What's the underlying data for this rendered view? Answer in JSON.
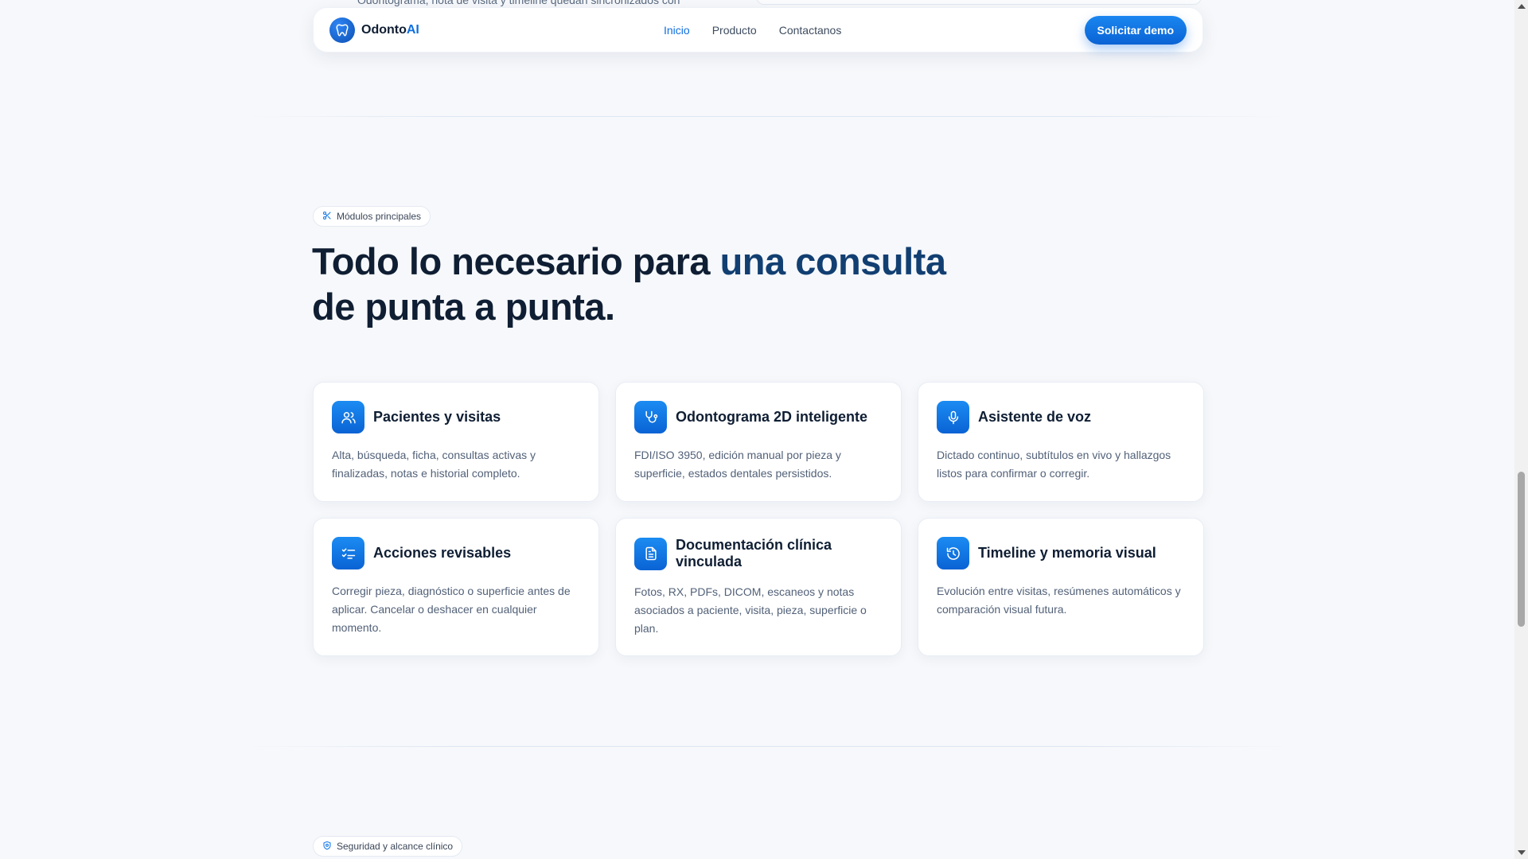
{
  "previous_section": {
    "trailing_text": "Odontograma, nota de visita y timeline quedan sincronizados con"
  },
  "header": {
    "brand_prefix": "Odonto",
    "brand_suffix": "AI",
    "nav": [
      {
        "label": "Inicio",
        "active": true
      },
      {
        "label": "Producto",
        "active": false
      },
      {
        "label": "Contactanos",
        "active": false
      }
    ],
    "cta_label": "Solicitar demo"
  },
  "modules": {
    "eyebrow": "Módulos principales",
    "headline_dark": "Todo lo necesario para ",
    "headline_accent": "una consulta",
    "headline_line2": "de punta a punta.",
    "cards": [
      {
        "icon": "users-icon",
        "title": "Pacientes y visitas",
        "description": "Alta, búsqueda, ficha, consultas activas y finalizadas, notas e historial completo."
      },
      {
        "icon": "stethoscope-icon",
        "title": "Odontograma 2D inteligente",
        "description": "FDI/ISO 3950, edición manual por pieza y superficie, estados dentales persistidos."
      },
      {
        "icon": "microphone-icon",
        "title": "Asistente de voz",
        "description": "Dictado continuo, subtítulos en vivo y hallazgos listos para confirmar o corregir."
      },
      {
        "icon": "checklist-icon",
        "title": "Acciones revisables",
        "description": "Corregir pieza, diagnóstico o superficie antes de aplicar. Cancelar o deshacer en cualquier momento."
      },
      {
        "icon": "document-icon",
        "title": "Documentación clínica vinculada",
        "description": "Fotos, RX, PDFs, DICOM, escaneos y notas asociados a paciente, visita, pieza, superficie o plan."
      },
      {
        "icon": "history-icon",
        "title": "Timeline y memoria visual",
        "description": "Evolución entre visitas, resúmenes automáticos y comparación visual futura."
      }
    ]
  },
  "next_section": {
    "eyebrow": "Seguridad y alcance clínico"
  },
  "colors": {
    "accent": "#0f6fe0",
    "headline_accent": "#123f72",
    "background": "#f6f8fb"
  }
}
